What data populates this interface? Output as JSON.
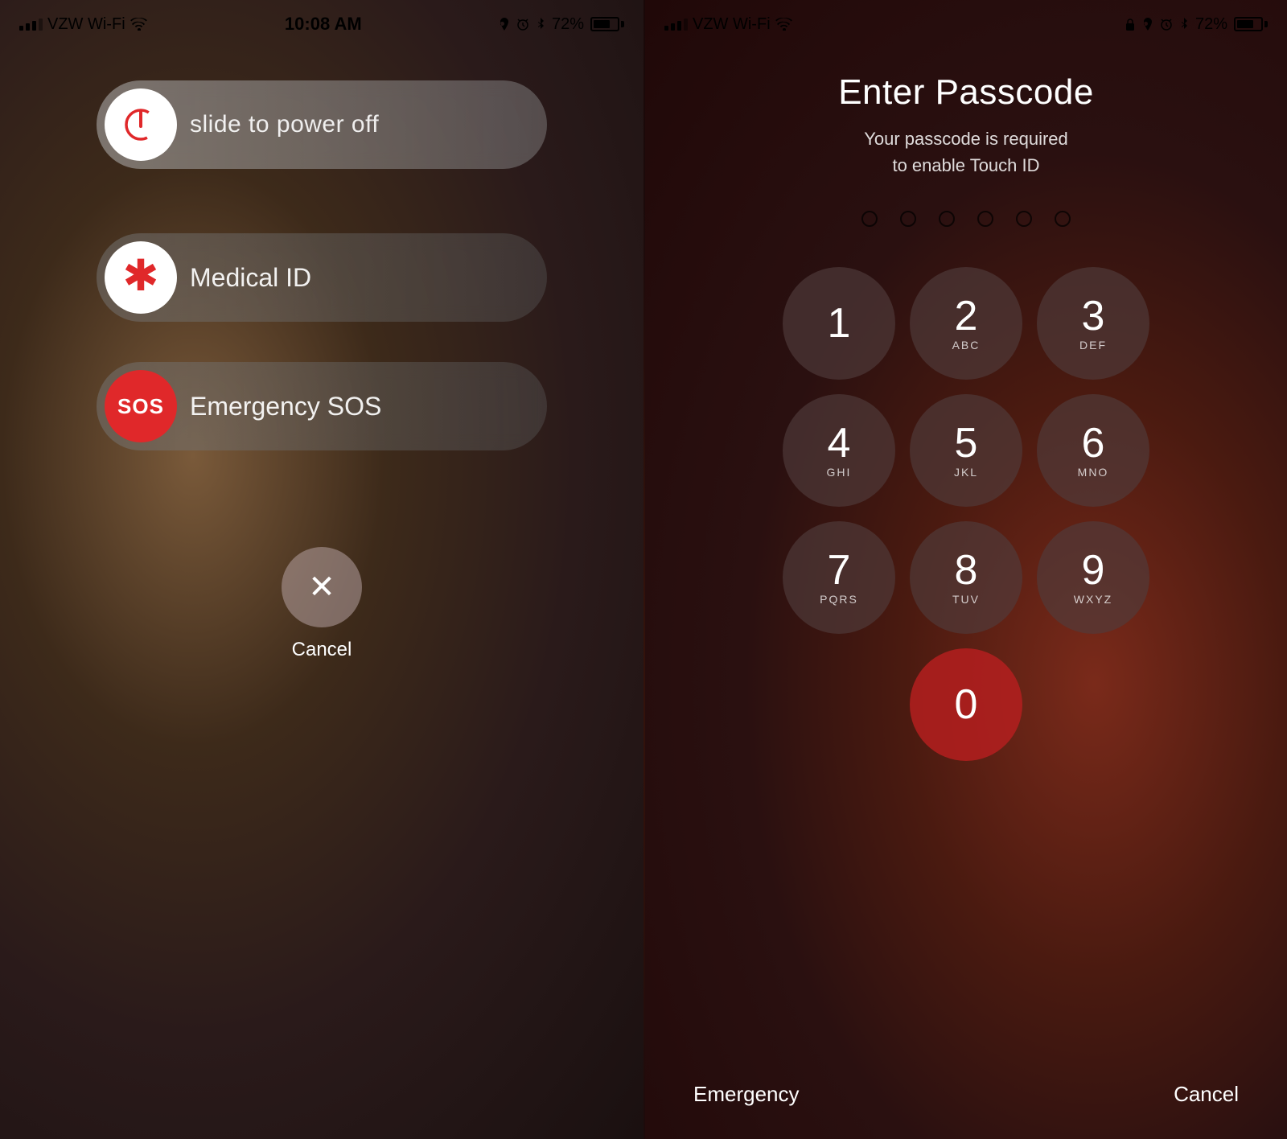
{
  "left_phone": {
    "status_bar": {
      "carrier": "VZW Wi-Fi",
      "time": "10:08 AM",
      "battery": "72%"
    },
    "slide_power_off": {
      "label": "slide to power off"
    },
    "medical_id": {
      "label": "Medical ID"
    },
    "emergency_sos": {
      "badge": "SOS",
      "label": "Emergency SOS"
    },
    "cancel": {
      "label": "Cancel"
    }
  },
  "right_phone": {
    "status_bar": {
      "carrier": "VZW Wi-Fi",
      "battery": "72%"
    },
    "title": "Enter Passcode",
    "subtitle": "Your passcode is required\nto enable Touch ID",
    "numpad": [
      {
        "digit": "1",
        "letters": ""
      },
      {
        "digit": "2",
        "letters": "ABC"
      },
      {
        "digit": "3",
        "letters": "DEF"
      },
      {
        "digit": "4",
        "letters": "GHI"
      },
      {
        "digit": "5",
        "letters": "JKL"
      },
      {
        "digit": "6",
        "letters": "MNO"
      },
      {
        "digit": "7",
        "letters": "PQRS"
      },
      {
        "digit": "8",
        "letters": "TUV"
      },
      {
        "digit": "9",
        "letters": "WXYZ"
      },
      {
        "digit": "",
        "letters": ""
      },
      {
        "digit": "0",
        "letters": ""
      },
      {
        "digit": "",
        "letters": ""
      }
    ],
    "bottom_emergency": "Emergency",
    "bottom_cancel": "Cancel"
  }
}
